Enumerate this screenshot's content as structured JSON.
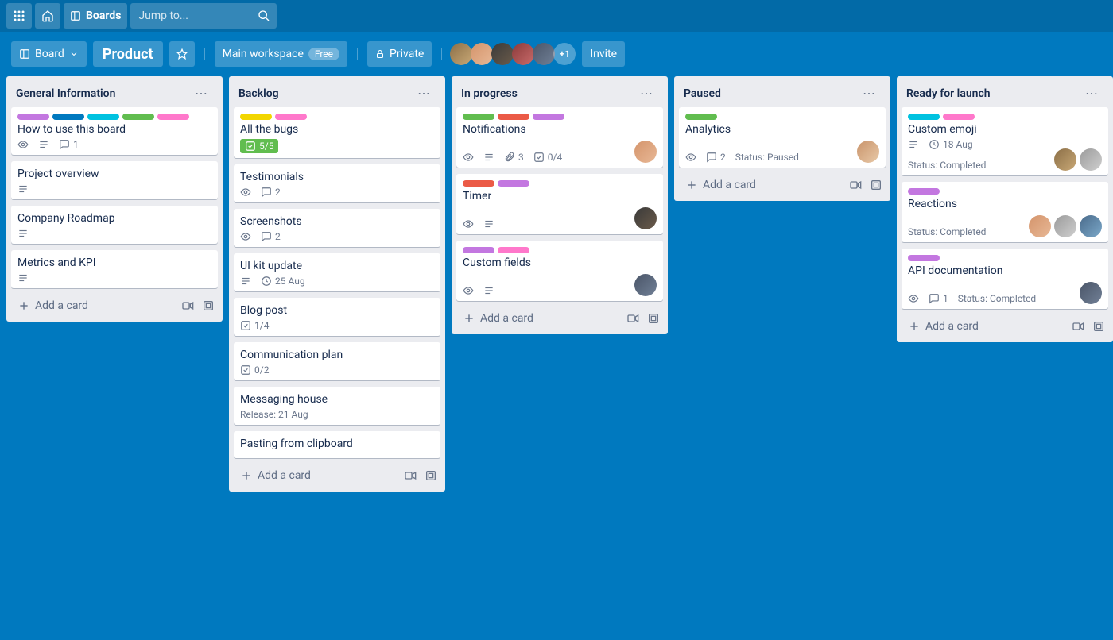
{
  "topbar": {
    "boards_label": "Boards",
    "search_placeholder": "Jump to..."
  },
  "boardbar": {
    "board_switch_label": "Board",
    "board_title": "Product",
    "workspace_label": "Main workspace",
    "workspace_badge": "Free",
    "visibility_label": "Private",
    "member_overflow": "+1",
    "invite_label": "Invite"
  },
  "lists": [
    {
      "title": "General Information",
      "cards": [
        {
          "labels": [
            "purple",
            "blue",
            "teal",
            "lime",
            "pink"
          ],
          "title": "How to use this board",
          "badges": {
            "watch": true,
            "desc": true,
            "comments": "1"
          }
        },
        {
          "title": "Project overview",
          "badges": {
            "desc": true
          }
        },
        {
          "title": "Company Roadmap",
          "badges": {
            "desc": true
          }
        },
        {
          "title": "Metrics and KPI",
          "badges": {
            "desc": true
          }
        }
      ],
      "add": "Add a card"
    },
    {
      "title": "Backlog",
      "cards": [
        {
          "labels": [
            "yellow",
            "pink"
          ],
          "title": "All the bugs",
          "badges": {
            "check_done": "5/5"
          }
        },
        {
          "title": "Testimonials",
          "badges": {
            "watch": true,
            "comments": "2"
          }
        },
        {
          "title": "Screenshots",
          "badges": {
            "watch": true,
            "comments": "2"
          }
        },
        {
          "title": "UI kit update",
          "badges": {
            "due": "25 Aug",
            "desc": true
          }
        },
        {
          "title": "Blog post",
          "badges": {
            "check": "1/4"
          }
        },
        {
          "title": "Communication plan",
          "badges": {
            "check": "0/2"
          }
        },
        {
          "title": "Messaging house",
          "badges": {
            "text": "Release: 21 Aug"
          }
        },
        {
          "title": "Pasting from clipboard"
        }
      ],
      "add": "Add a card"
    },
    {
      "title": "In progress",
      "cards": [
        {
          "labels": [
            "green",
            "red",
            "lightpurple"
          ],
          "title": "Notifications",
          "badges": {
            "watch": true,
            "desc": true,
            "attach": "3",
            "check": "0/4"
          },
          "avatars": [
            "av2"
          ]
        },
        {
          "labels": [
            "red",
            "lightpurple"
          ],
          "title": "Timer",
          "badges": {
            "watch": true,
            "desc": true
          },
          "avatars": [
            "av3"
          ]
        },
        {
          "labels": [
            "lightpurple",
            "pink"
          ],
          "title": "Custom fields",
          "badges": {
            "watch": true,
            "desc": true
          },
          "avatars": [
            "av5"
          ]
        }
      ],
      "add": "Add a card"
    },
    {
      "title": "Paused",
      "cards": [
        {
          "labels": [
            "green"
          ],
          "title": "Analytics",
          "badges": {
            "watch": true,
            "comments": "2",
            "text": "Status: Paused"
          },
          "avatars": [
            "av8"
          ]
        }
      ],
      "add": "Add a card"
    },
    {
      "title": "Ready for launch",
      "cards": [
        {
          "labels": [
            "teal",
            "pink"
          ],
          "title": "Custom emoji",
          "badges": {
            "due": "18 Aug",
            "desc": true,
            "text": "Status: Completed"
          },
          "avatars": [
            "av1",
            "av9"
          ]
        },
        {
          "labels": [
            "lightpurple"
          ],
          "title": "Reactions",
          "badges": {
            "text": "Status: Completed"
          },
          "avatars": [
            "av2",
            "av9",
            "av10"
          ]
        },
        {
          "labels": [
            "lightpurple"
          ],
          "title": "API documentation",
          "badges": {
            "watch": true,
            "comments": "1",
            "text": "Status: Completed"
          },
          "avatars": [
            "av5"
          ]
        }
      ],
      "add": "Add a card"
    }
  ]
}
